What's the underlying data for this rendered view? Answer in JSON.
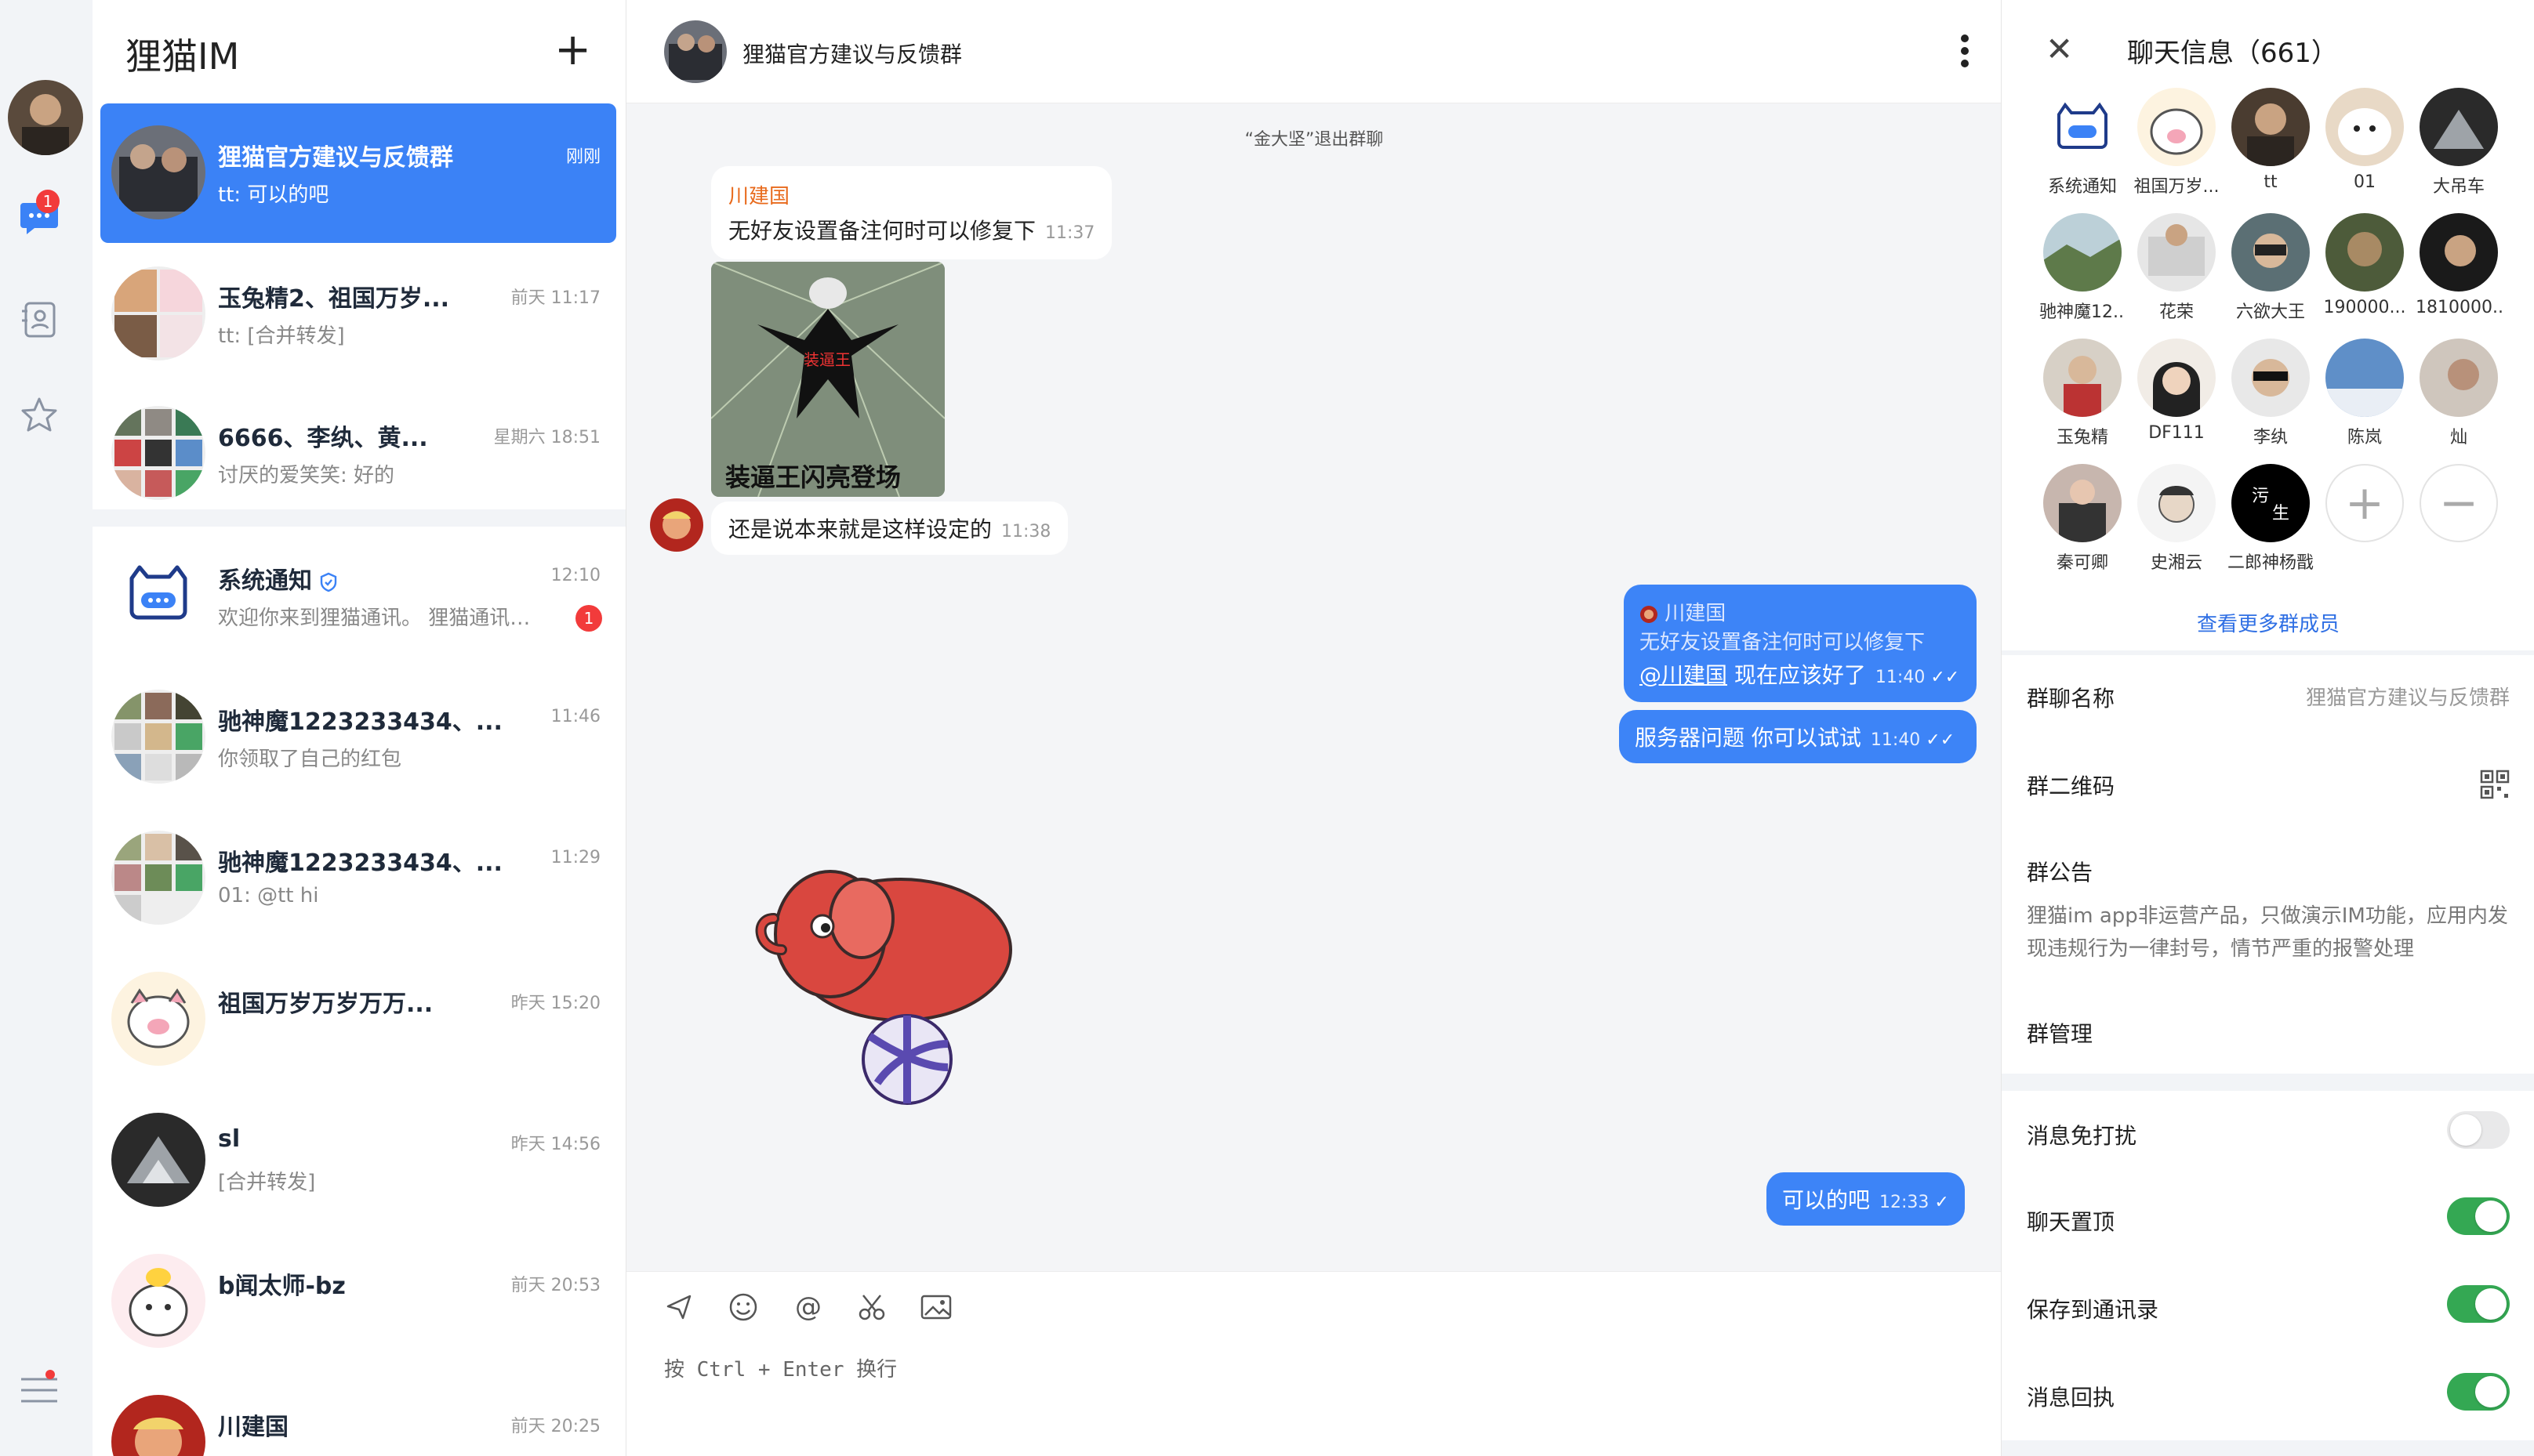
{
  "app": {
    "title": "狸猫IM"
  },
  "nav": {
    "chat_badge": "1"
  },
  "conversations": [
    {
      "name": "狸猫官方建议与反馈群",
      "time": "刚刚",
      "last": "tt: 可以的吧",
      "active": true
    },
    {
      "name": "玉兔精2、祖国万岁...",
      "time": "前天 11:17",
      "last": "tt: [合并转发]"
    },
    {
      "name": "6666、李纨、黄...",
      "time": "星期六 18:51",
      "last": "讨厌的爱笑笑: 好的"
    },
    {
      "name": "系统通知",
      "time": "12:10",
      "last": "欢迎你来到狸猫通讯。 狸猫通讯安...",
      "badge": "1"
    },
    {
      "name": "驰神魔1223233434、...",
      "time": "11:46",
      "last": "你领取了自己的红包"
    },
    {
      "name": "驰神魔1223233434、...",
      "time": "11:29",
      "last": "01: @tt hi"
    },
    {
      "name": "祖国万岁万岁万万...",
      "time": "昨天 15:20",
      "last": ""
    },
    {
      "name": "sl",
      "time": "昨天 14:56",
      "last": "[合并转发]"
    },
    {
      "name": "b闻太师-bz",
      "time": "前天 20:53",
      "last": ""
    },
    {
      "name": "川建国",
      "time": "前天 20:25",
      "last": ""
    }
  ],
  "chat": {
    "title": "狸猫官方建议与反馈群",
    "system_msg": "“金大坚”退出群聊",
    "m1_sender": "川建国",
    "m1_text": "无好友设置备注何时可以修复下",
    "m1_time": "11:37",
    "meme_caption": "装逼王闪亮登场",
    "m2_text": "还是说本来就是这样设定的",
    "m2_time": "11:38",
    "m3_quote_sender": "川建国",
    "m3_quote_text": "无好友设置备注何时可以修复下",
    "m3_mention": "@川建国",
    "m3_text": " 现在应该好了",
    "m3_time": "11:40",
    "m4_text": "服务器问题 你可以试试",
    "m4_time": "11:40",
    "m5_text": "可以的吧",
    "m5_time": "12:33",
    "input_placeholder": "按 Ctrl + Enter 换行"
  },
  "info": {
    "title": "聊天信息（661）",
    "members": [
      "系统通知",
      "祖国万岁...",
      "tt",
      "01",
      "大吊车",
      "驰神魔12...",
      "花荣",
      "六欲大王",
      "190000...",
      "1810000...",
      "玉兔精",
      "DF111",
      "李纨",
      "陈岚",
      "灿",
      "秦可卿",
      "史湘云",
      "二郎神杨戬"
    ],
    "more_members": "查看更多群成员",
    "group_name_label": "群聊名称",
    "group_name_value": "狸猫官方建议与反馈群",
    "qr_label": "群二维码",
    "notice_label": "群公告",
    "notice_text": "狸猫im app非运营产品，只做演示IM功能，应用内发现违规行为一律封号，情节严重的报警处理",
    "manage_label": "群管理",
    "mute_label": "消息免打扰",
    "mute_on": false,
    "pin_label": "聊天置顶",
    "pin_on": true,
    "save_label": "保存到通讯录",
    "save_on": true,
    "receipt_label": "消息回执",
    "receipt_on": true
  },
  "colors": {
    "accent": "#3b82f6",
    "bubble_me": "#3d84f7",
    "toggle_on": "#34a853",
    "badge": "#f23b3b",
    "sender": "#e86a1c"
  }
}
